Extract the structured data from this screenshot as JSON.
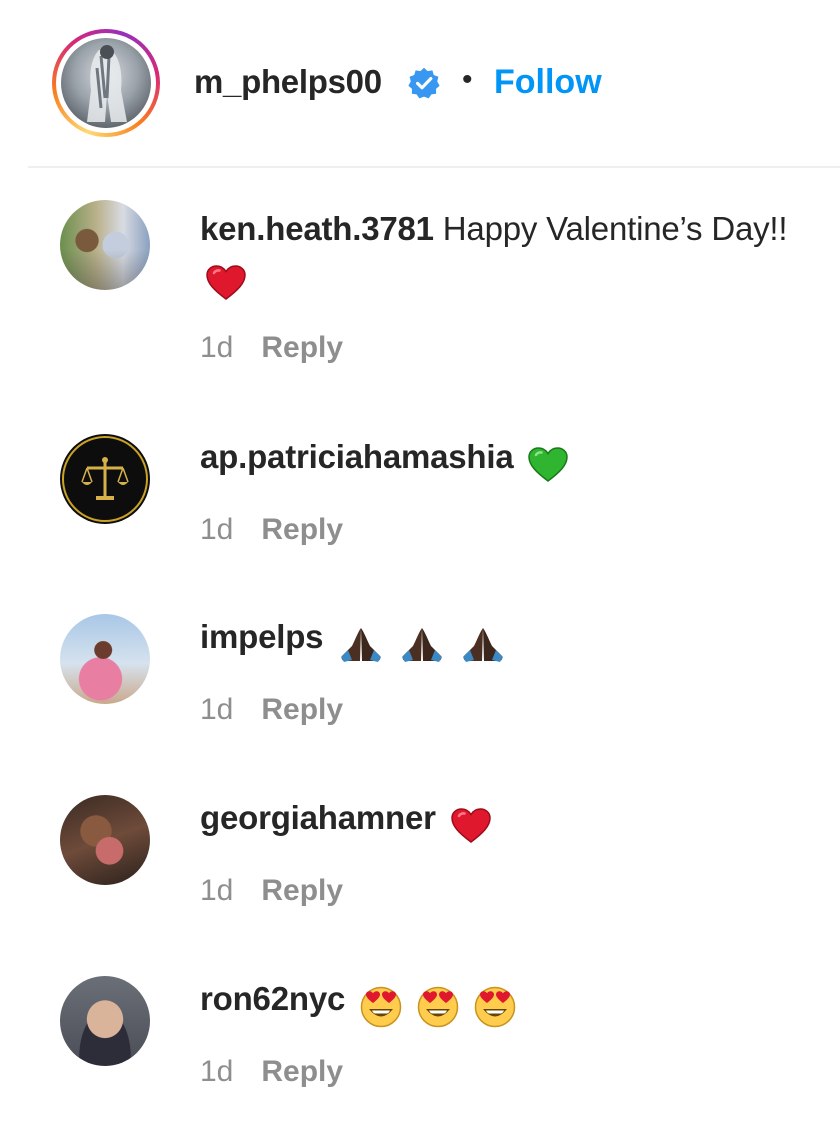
{
  "header": {
    "username": "m_phelps00",
    "separator": "•",
    "follow_label": "Follow",
    "verified_icon": "verified-badge-icon",
    "accent_color": "#0095f6"
  },
  "comments": [
    {
      "username": "ken.heath.3781",
      "text": " Happy Valentine’s Day!! ",
      "emoji": [
        "red-heart"
      ],
      "time": "1d",
      "reply_label": "Reply"
    },
    {
      "username": "ap.patriciahamashia",
      "text": " ",
      "emoji": [
        "green-heart"
      ],
      "time": "1d",
      "reply_label": "Reply"
    },
    {
      "username": "impelps",
      "text": " ",
      "emoji": [
        "folded-hands-dark",
        "folded-hands-dark",
        "folded-hands-dark"
      ],
      "time": "1d",
      "reply_label": "Reply"
    },
    {
      "username": "georgiahamner",
      "text": " ",
      "emoji": [
        "red-heart"
      ],
      "time": "1d",
      "reply_label": "Reply"
    },
    {
      "username": "ron62nyc",
      "text": " ",
      "emoji": [
        "heart-eyes-face",
        "heart-eyes-face",
        "heart-eyes-face"
      ],
      "time": "1d",
      "reply_label": "Reply"
    }
  ]
}
